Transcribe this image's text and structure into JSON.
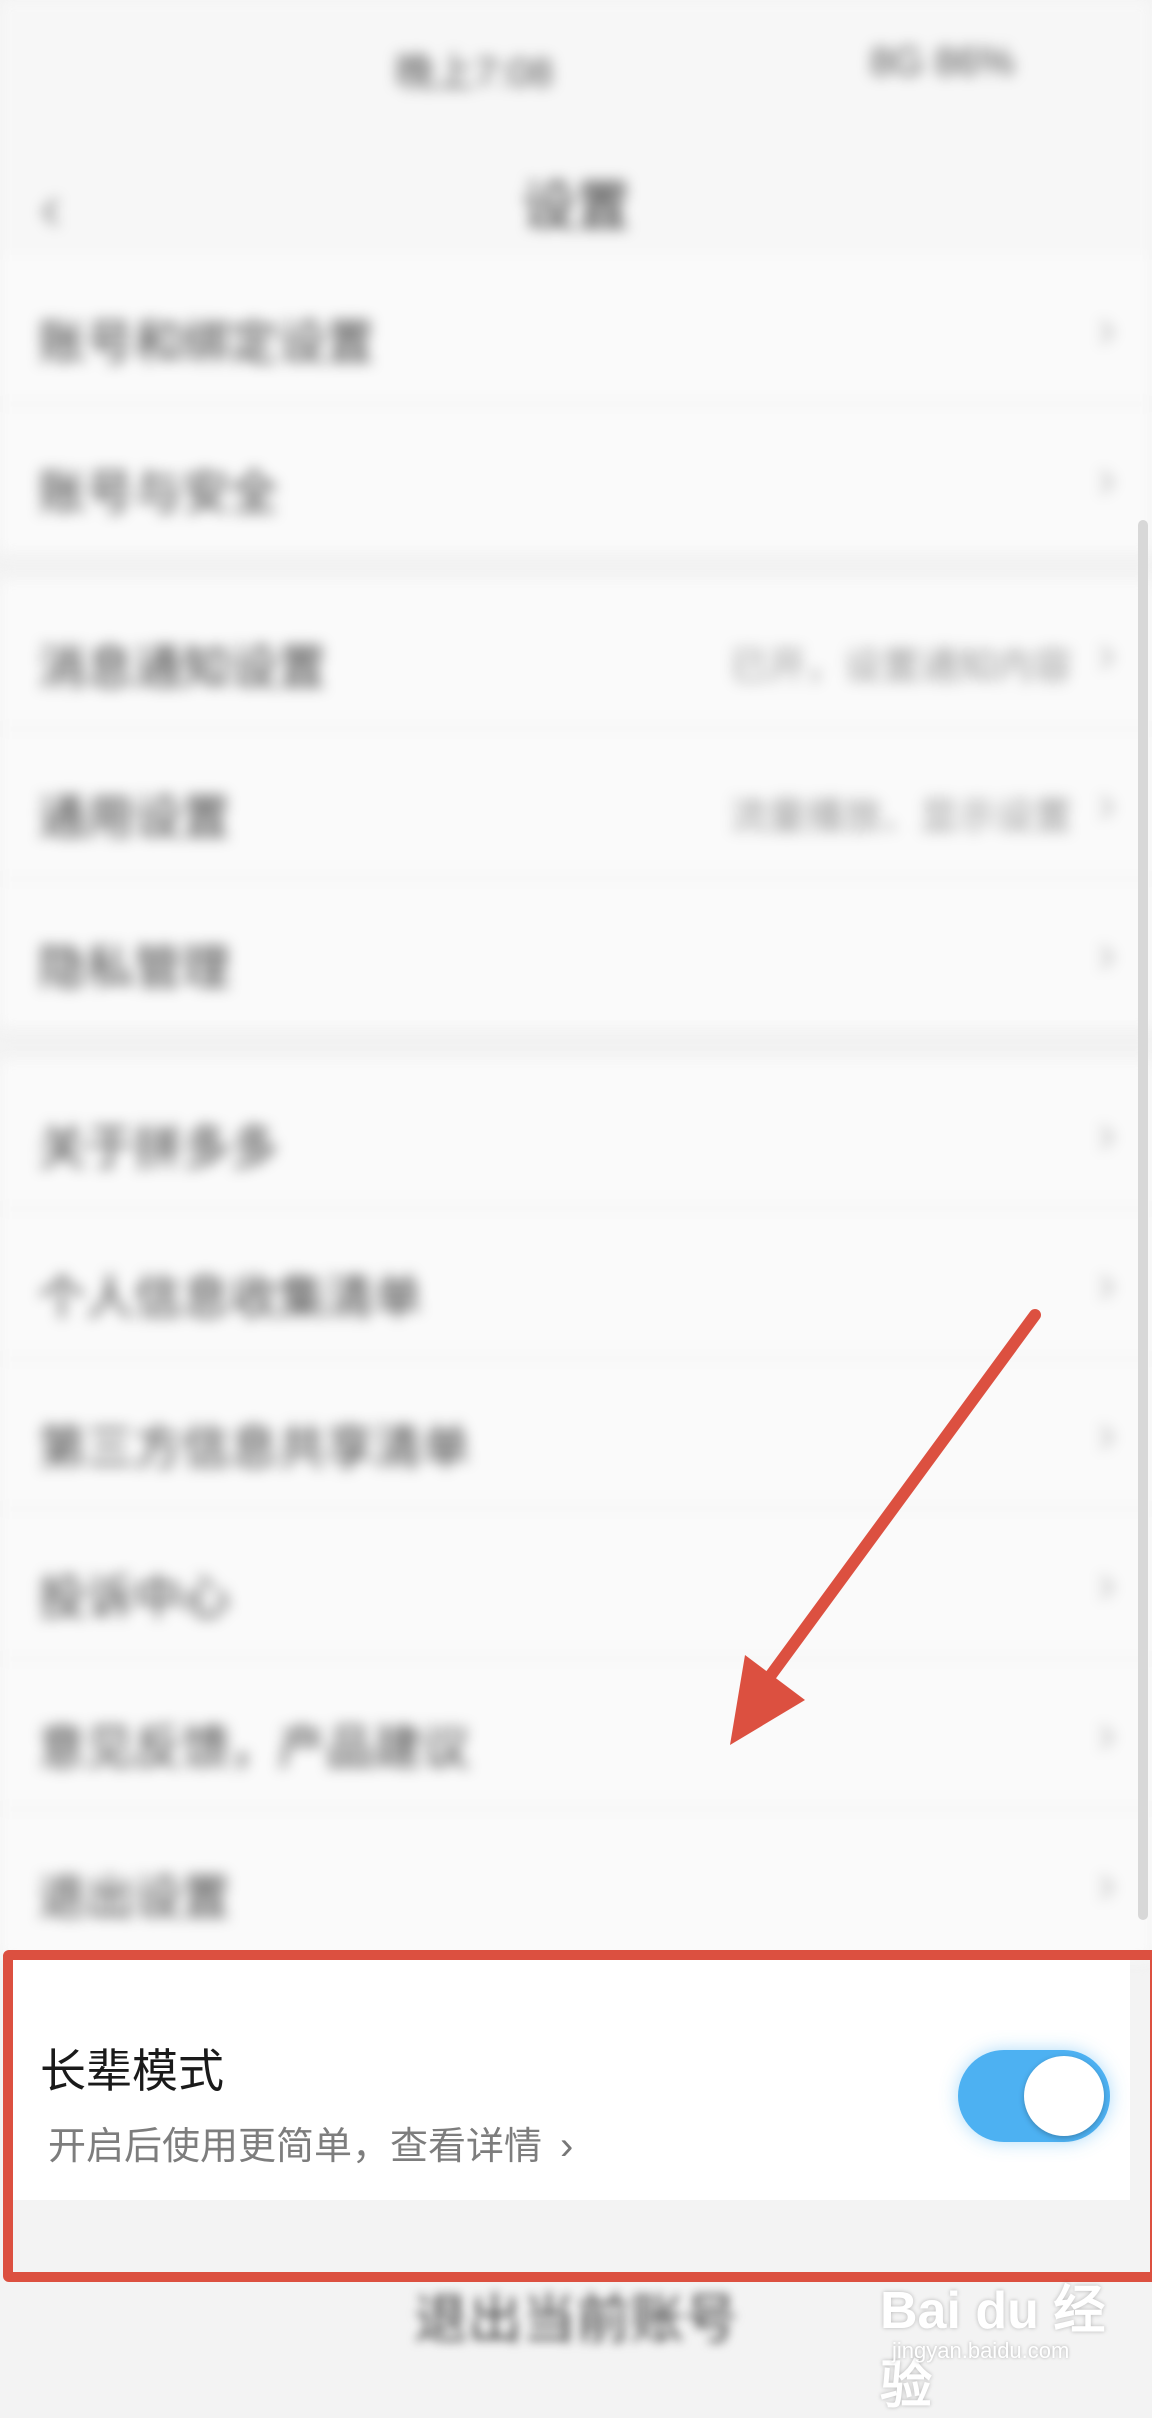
{
  "status_bar": {
    "left_text": "晚上7:08",
    "right_text": "8G 86%"
  },
  "header": {
    "title": "设置",
    "back_icon": "chevron-left-icon"
  },
  "settings_groups": [
    {
      "rows": [
        {
          "label": "账号和绑定设置",
          "value": ""
        },
        {
          "label": "账号与安全",
          "value": ""
        }
      ]
    },
    {
      "rows": [
        {
          "label": "消息通知设置",
          "value": "已开，设置通知内容"
        },
        {
          "label": "通用设置",
          "value": "流量播放、显示设置"
        },
        {
          "label": "隐私管理",
          "value": ""
        }
      ]
    },
    {
      "rows": [
        {
          "label": "关于拼多多",
          "value": ""
        },
        {
          "label": "个人信息收集清单",
          "value": ""
        },
        {
          "label": "第三方信息共享清单",
          "value": ""
        },
        {
          "label": "投诉中心",
          "value": ""
        },
        {
          "label": "意见反馈，产品建议",
          "value": ""
        },
        {
          "label": "退出设置",
          "value": ""
        }
      ]
    }
  ],
  "elder_mode": {
    "title": "长辈模式",
    "subtitle": "开启后使用更简单，查看详情",
    "toggle_on": true,
    "toggle_color": "#4db1f2"
  },
  "logout_label": "退出当前账号",
  "annotation": {
    "color": "#dc5040"
  },
  "watermark": {
    "brand": "Bai du 经验",
    "site": "jingyan.baidu.com"
  }
}
